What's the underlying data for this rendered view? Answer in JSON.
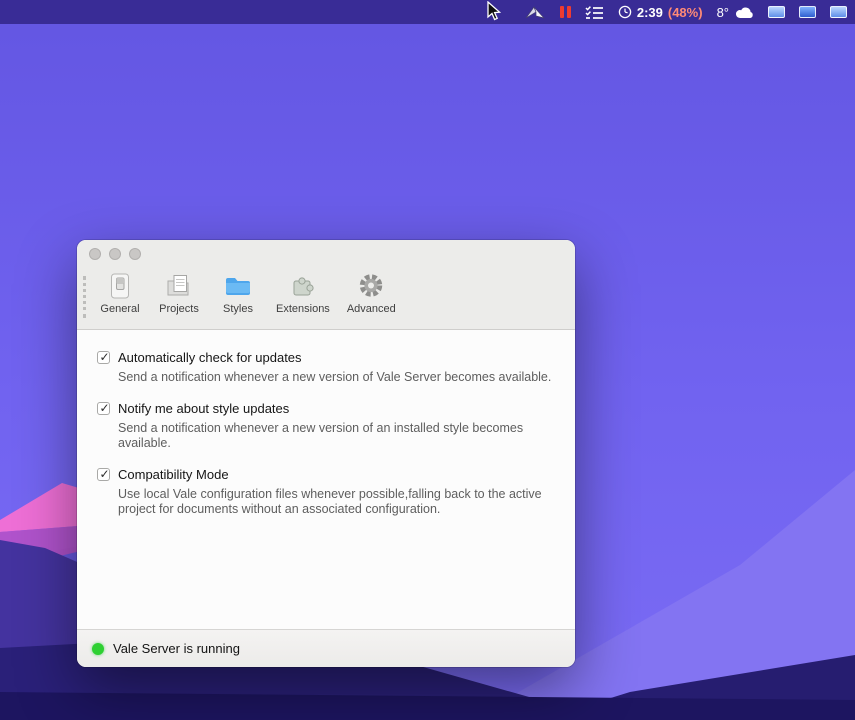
{
  "menu_bar": {
    "time": "2:39",
    "battery": "(48%)",
    "temperature": "8°",
    "icons": [
      "app-icon",
      "pause-icon",
      "tasks-icon",
      "clock-icon",
      "weather-cloud-icon",
      "display-icon",
      "keyboard-icon"
    ]
  },
  "window": {
    "toolbar": {
      "tabs": [
        {
          "label": "General",
          "selected": true
        },
        {
          "label": "Projects",
          "selected": false
        },
        {
          "label": "Styles",
          "selected": false
        },
        {
          "label": "Extensions",
          "selected": false
        },
        {
          "label": "Advanced",
          "selected": false
        }
      ]
    },
    "settings": [
      {
        "label": "Automatically check for updates",
        "checked": true,
        "description": "Send a notification whenever a new version of Vale Server becomes available."
      },
      {
        "label": "Notify me about style updates",
        "checked": true,
        "description": "Send a notification whenever a new version of an installed style becomes available."
      },
      {
        "label": "Compatibility Mode",
        "checked": true,
        "description": "Use local Vale configuration files whenever possible,falling back to the active project for documents without an associated configuration."
      }
    ],
    "status_bar": {
      "status": "Vale Server is running"
    }
  },
  "colors": {
    "status_green": "#2ed032",
    "battery_warning": "#ff8a76"
  }
}
